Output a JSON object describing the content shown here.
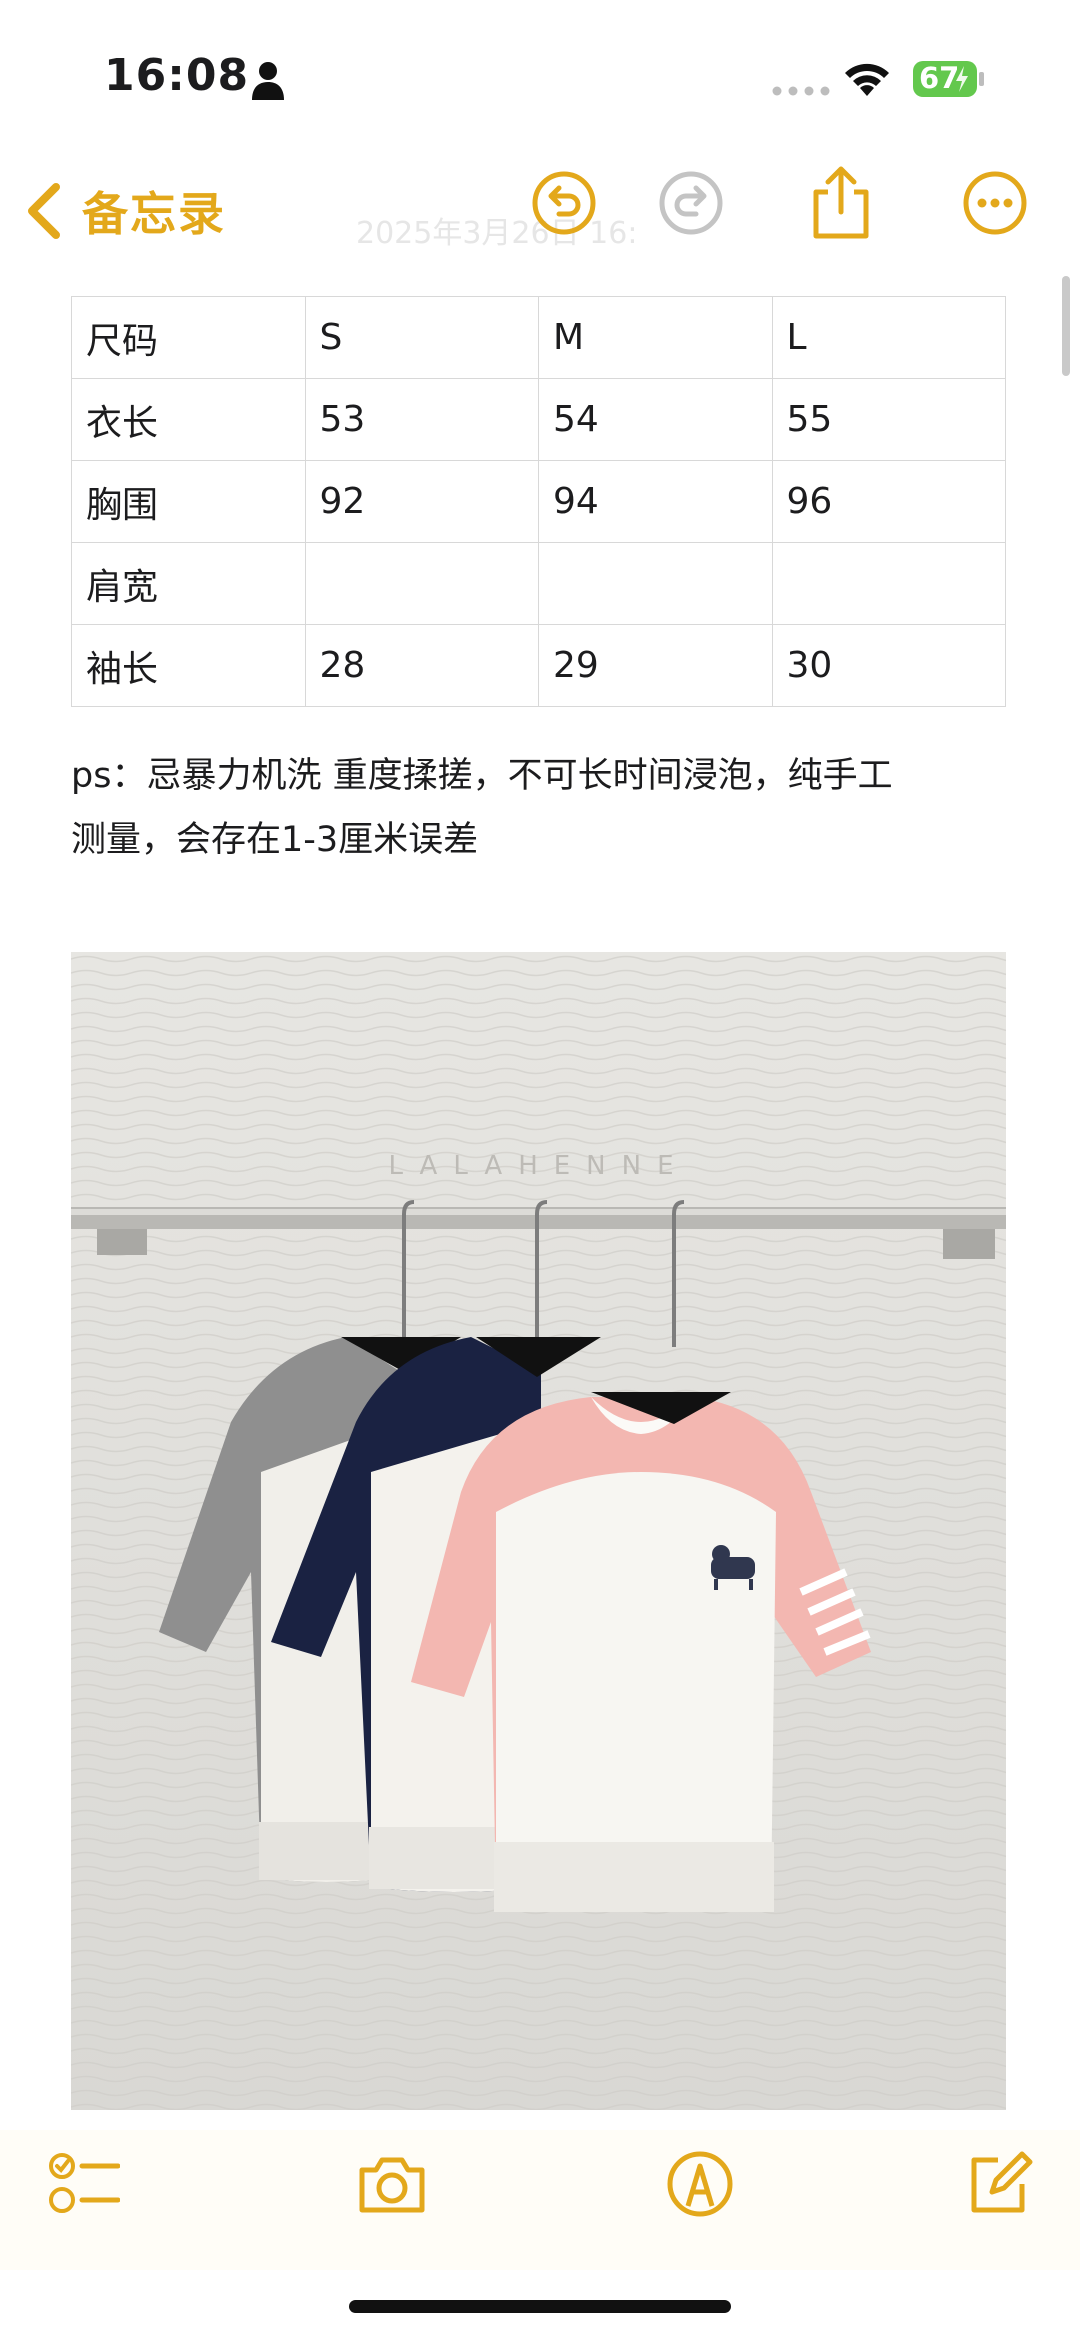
{
  "status_bar": {
    "time": "16:08",
    "battery_level": "67"
  },
  "nav": {
    "back_label": "备忘录",
    "faded_date": "2025年3月26日 16:"
  },
  "size_table": {
    "rows": [
      [
        "尺码",
        "S",
        "M",
        "L"
      ],
      [
        "衣长",
        "53",
        "54",
        "55"
      ],
      [
        "胸围",
        "92",
        "94",
        "96"
      ],
      [
        "肩宽",
        "",
        "",
        ""
      ],
      [
        "袖长",
        "28",
        "29",
        "30"
      ]
    ]
  },
  "note": {
    "line1": "ps：忌暴力机洗 重度揉搓，不可长时间浸泡，纯手工",
    "line2": "测量，会存在1-3厘米误差"
  },
  "photo": {
    "watermark": "LALAHENNE",
    "description_icon": "photo-garments-on-rack"
  },
  "colors": {
    "accent": "#e3a81b",
    "battery_green": "#63c84d"
  },
  "icons": {
    "undo": "undo-icon",
    "redo": "redo-icon",
    "share": "share-icon",
    "more": "more-icon",
    "checklist": "checklist-icon",
    "camera": "camera-icon",
    "markup": "markup-icon",
    "compose": "compose-icon"
  }
}
